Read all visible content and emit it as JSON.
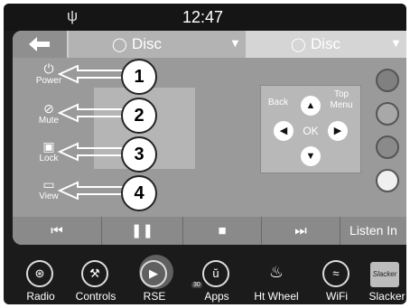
{
  "status": {
    "time": "12:47",
    "usb_icon": "usb-icon"
  },
  "tabs": [
    {
      "label": "Disc",
      "icon": "bluray-disc-icon",
      "arrow": "dropdown-arrow-icon"
    },
    {
      "label": "Disc",
      "icon": "bluray-disc-icon",
      "arrow": "dropdown-arrow-icon"
    }
  ],
  "left_buttons": [
    {
      "label": "Power",
      "icon": "power-icon",
      "callout": "1"
    },
    {
      "label": "Mute",
      "icon": "mute-icon",
      "callout": "2"
    },
    {
      "label": "Lock",
      "icon": "lock-icon",
      "callout": "3"
    },
    {
      "label": "View",
      "icon": "view-icon",
      "callout": "4"
    }
  ],
  "dpad": {
    "back": "Back",
    "top_menu_1": "Top",
    "top_menu_2": "Menu",
    "ok": "OK"
  },
  "color_buttons": [
    "#808080",
    "#a8a8a8",
    "#8a8a8a",
    "#f0f0f0"
  ],
  "transport": {
    "listen_in": "Listen In"
  },
  "dock": [
    {
      "label": "Radio",
      "icon": "radio-icon"
    },
    {
      "label": "Controls",
      "icon": "controls-icon"
    },
    {
      "label": "RSE",
      "icon": "rse-icon"
    },
    {
      "label": "Apps",
      "icon": "apps-icon",
      "badge": "30"
    },
    {
      "label": "Ht Wheel",
      "icon": "heated-wheel-icon"
    },
    {
      "label": "WiFi",
      "icon": "wifi-icon"
    },
    {
      "label": "Slacker",
      "icon": "slacker-icon",
      "logo_text": "Slacker"
    }
  ]
}
